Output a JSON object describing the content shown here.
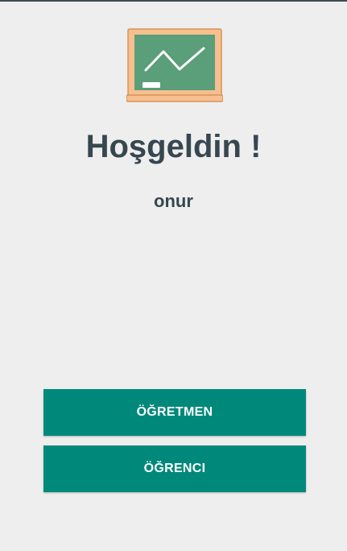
{
  "header": {
    "title": "Hoşgeldin !",
    "username": "onur"
  },
  "actions": {
    "teacher_label": "ÖĞRETMEN",
    "student_label": "ÖĞRENCI"
  },
  "colors": {
    "background": "#eeeeee",
    "text": "#37474f",
    "button": "#00897b",
    "board_green": "#5a9e7a",
    "board_frame": "#f6bf8f"
  },
  "icons": {
    "logo": "chalkboard-icon"
  }
}
